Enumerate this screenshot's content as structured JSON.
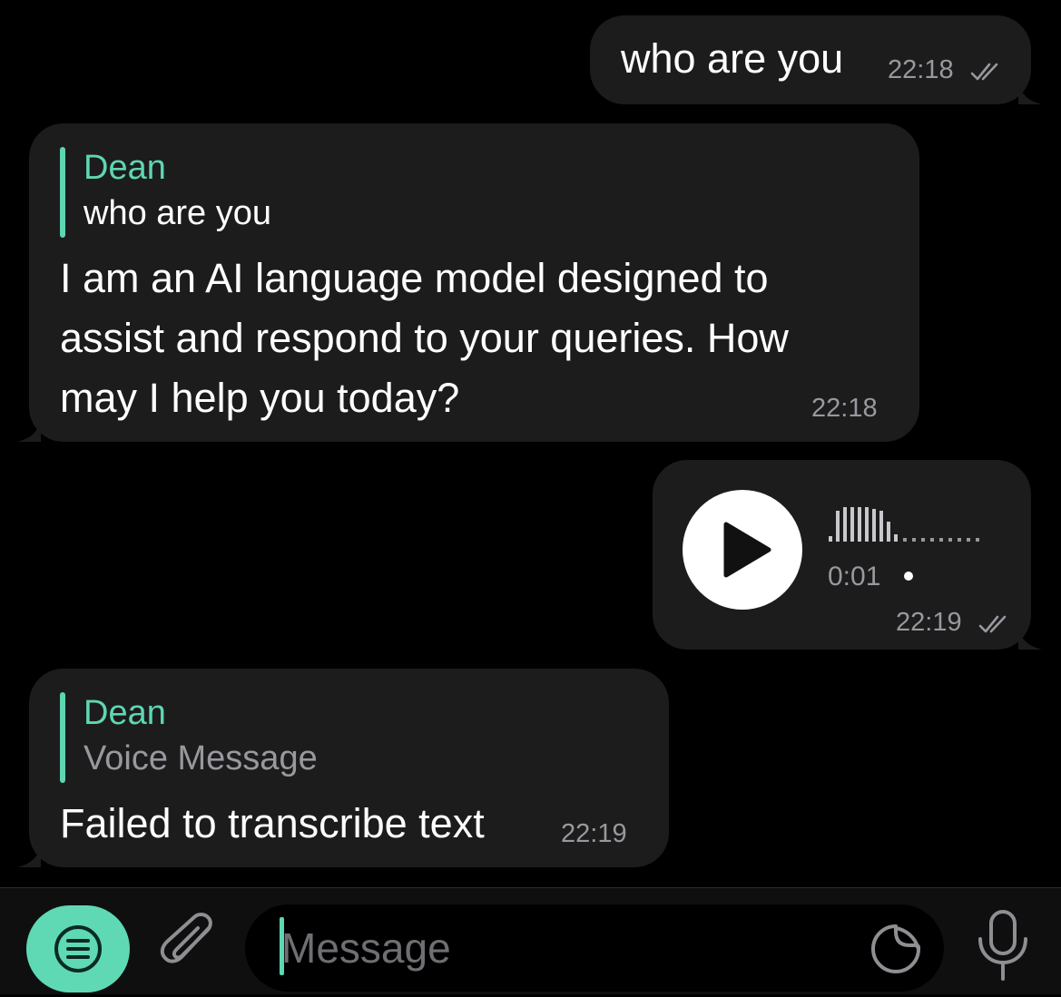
{
  "messages": [
    {
      "type": "outgoing-text",
      "text": "who are you",
      "time": "22:18",
      "status": "read"
    },
    {
      "type": "incoming-reply",
      "reply_name": "Dean",
      "reply_text": "who are you",
      "lines": [
        "I am an AI language model designed to",
        "assist and respond to your queries. How",
        "may I help you today?"
      ],
      "time": "22:18"
    },
    {
      "type": "outgoing-voice",
      "duration": "0:01",
      "time": "22:19",
      "status": "read"
    },
    {
      "type": "incoming-reply",
      "reply_name": "Dean",
      "reply_text": "Voice Message",
      "text": "Failed to transcribe text",
      "time": "22:19"
    }
  ],
  "input": {
    "placeholder": "Message"
  },
  "icons": {
    "menu": "menu-icon",
    "attach": "paperclip-icon",
    "sticker": "sticker-icon",
    "mic": "microphone-icon",
    "play": "play-icon",
    "read": "double-check-icon"
  },
  "colors": {
    "background": "#000000",
    "bubble": "#1c1c1d",
    "accent": "#5ed6b2",
    "muted_text": "#98989e",
    "input_bar": "#0f0f10"
  }
}
